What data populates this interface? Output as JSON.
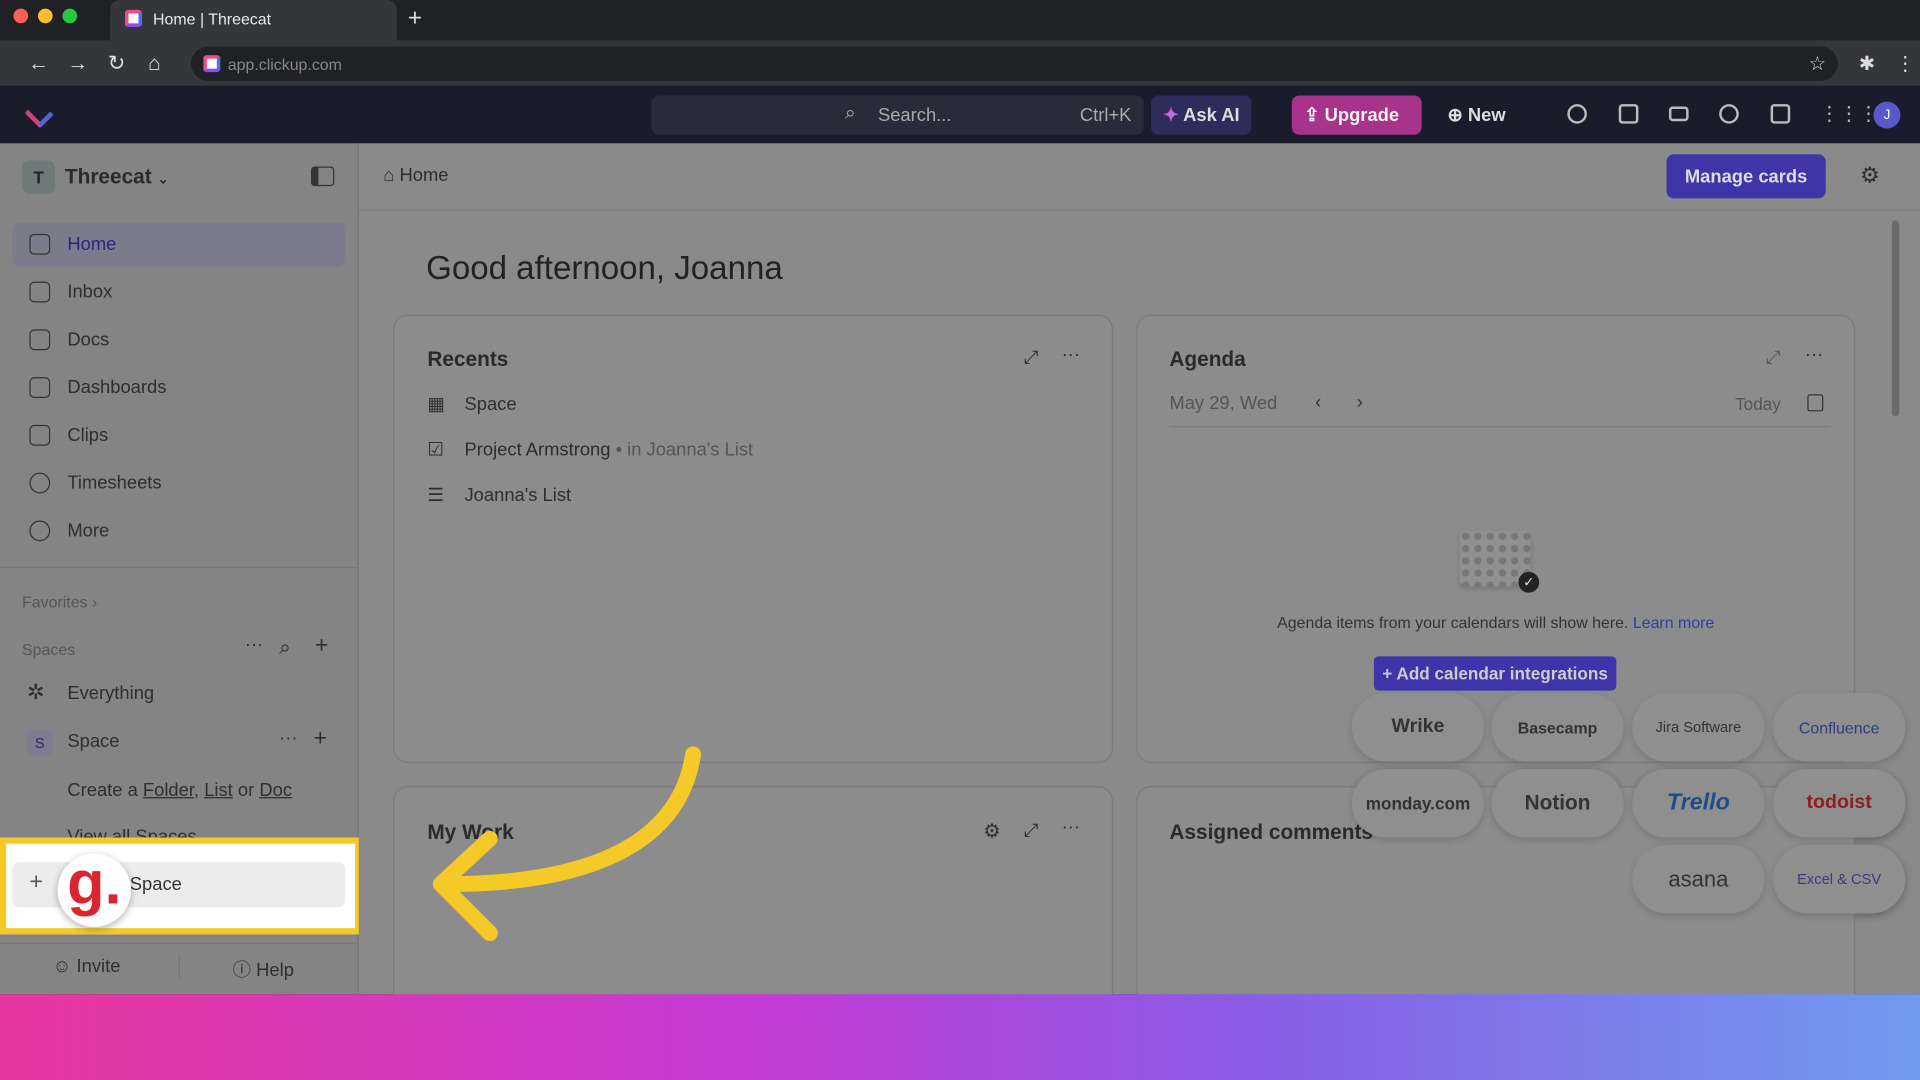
{
  "browser": {
    "tab_title": "Home | Threecat",
    "url": "app.clickup.com"
  },
  "topbar": {
    "search_placeholder": "Search...",
    "search_shortcut": "Ctrl+K",
    "ask_ai": "Ask AI",
    "upgrade": "Upgrade",
    "new": "New",
    "avatar_initial": "J"
  },
  "sidebar": {
    "workspace_initial": "T",
    "workspace": "Threecat",
    "items": [
      {
        "label": "Home",
        "icon": "home-icon"
      },
      {
        "label": "Inbox",
        "icon": "inbox-icon"
      },
      {
        "label": "Docs",
        "icon": "docs-icon"
      },
      {
        "label": "Dashboards",
        "icon": "dashboards-icon"
      },
      {
        "label": "Clips",
        "icon": "clips-icon"
      },
      {
        "label": "Timesheets",
        "icon": "timesheets-icon"
      },
      {
        "label": "More",
        "icon": "more-icon"
      }
    ],
    "favorites": "Favorites",
    "spaces": "Spaces",
    "everything": "Everything",
    "space_initial": "S",
    "space": "Space",
    "create_prefix": "Create a",
    "create_folder": "Folder",
    "create_list": "List",
    "create_or": "or",
    "create_doc": "Doc",
    "view_all": "View all Spaces",
    "new_space": "Space",
    "invite": "Invite",
    "help": "Help"
  },
  "header": {
    "breadcrumb": "Home",
    "manage_cards": "Manage cards"
  },
  "greeting": "Good afternoon, Joanna",
  "recents": {
    "title": "Recents",
    "items": [
      {
        "label": "Space",
        "icon": "table-icon"
      },
      {
        "label": "Project Armstrong",
        "location": "• in Joanna's List",
        "icon": "task-check-icon"
      },
      {
        "label": "Joanna's List",
        "icon": "list-icon"
      }
    ]
  },
  "agenda": {
    "title": "Agenda",
    "date": "May 29, Wed",
    "today": "Today",
    "empty": "Agenda items from your calendars will show here.",
    "learn_more": "Learn more",
    "add_button": "Add calendar integrations",
    "integrations": [
      "Wrike",
      "Basecamp",
      "Jira Software",
      "Confluence",
      "monday.com",
      "Notion",
      "Trello",
      "todoist",
      "asana",
      "Excel & CSV"
    ]
  },
  "my_work": {
    "title": "My Work"
  },
  "assigned_comments": {
    "title": "Assigned comments"
  },
  "colors": {
    "accent": "#3d35a8",
    "upgrade": "#b0308f",
    "highlight": "#f5c928",
    "arrow": "#f5c928",
    "logo_red": "#d9252d"
  }
}
